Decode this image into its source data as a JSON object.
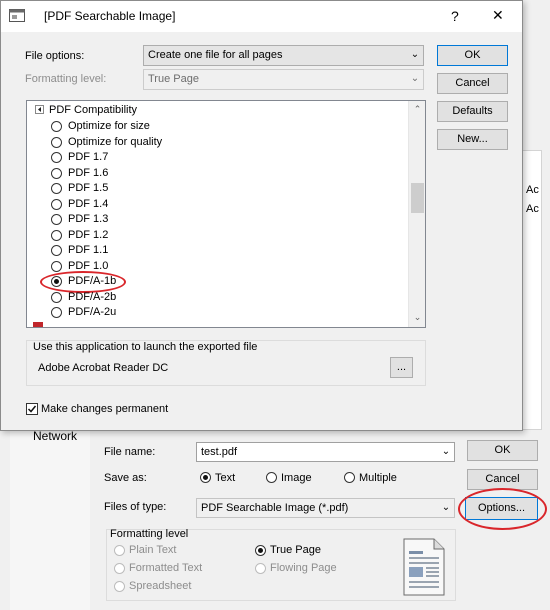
{
  "back_dialog": {
    "network_label": "Network",
    "right_frag_1": "Ac",
    "right_frag_2": "Ac",
    "file_name_label": "File name:",
    "file_name_value": "test.pdf",
    "ok_label": "OK",
    "save_as_label": "Save as:",
    "save_as_options": [
      "Text",
      "Image",
      "Multiple"
    ],
    "save_as_selected": "Text",
    "cancel_label": "Cancel",
    "files_of_type_label": "Files of type:",
    "files_of_type_value": "PDF Searchable Image (*.pdf)",
    "options_label": "Options...",
    "formatting_level_title": "Formatting level",
    "formatting_options": [
      "Plain Text",
      "Formatted Text",
      "Spreadsheet",
      "True Page",
      "Flowing Page"
    ],
    "formatting_selected": "True Page",
    "highlight_color": "#d9262b"
  },
  "dialog": {
    "title": "[PDF Searchable Image]",
    "help_glyph": "?",
    "close_glyph": "✕",
    "file_options_label": "File options:",
    "file_options_value": "Create one file for all pages",
    "formatting_level_label": "Formatting level:",
    "formatting_level_value": "True Page",
    "ok_label": "OK",
    "cancel_label": "Cancel",
    "defaults_label": "Defaults",
    "new_label": "New...",
    "tree": {
      "group_label": "PDF Compatibility",
      "items": [
        "Optimize for size",
        "Optimize for quality",
        "PDF 1.7",
        "PDF 1.6",
        "PDF 1.5",
        "PDF 1.4",
        "PDF 1.3",
        "PDF 1.2",
        "PDF 1.1",
        "PDF 1.0",
        "PDF/A-1b",
        "PDF/A-2b",
        "PDF/A-2u"
      ],
      "selected": "PDF/A-1b"
    },
    "launch_group_label": "Use this application to launch the exported file",
    "launch_app": "Adobe Acrobat Reader DC",
    "browse_label": "...",
    "make_permanent_label": "Make changes permanent",
    "make_permanent_checked": true
  }
}
